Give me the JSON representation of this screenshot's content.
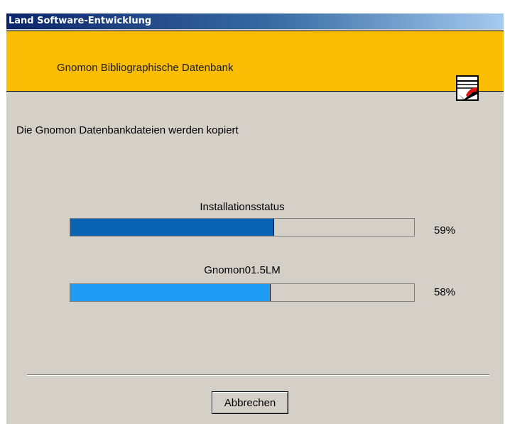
{
  "window": {
    "title": "Land Software-Entwicklung"
  },
  "banner": {
    "title": "Gnomon Bibliographische Datenbank",
    "logo_icon": "gnomon-logo-icon"
  },
  "status_text": "Die Gnomon Datenbankdateien werden kopiert",
  "progress": [
    {
      "label": "Installationsstatus",
      "percent_text": "59%",
      "value": 59,
      "color": "#0a64b4"
    },
    {
      "label": "Gnomon01.5LM",
      "percent_text": "58%",
      "value": 58,
      "color": "#1e9bf5"
    }
  ],
  "buttons": {
    "cancel_label": "Abbrechen"
  }
}
